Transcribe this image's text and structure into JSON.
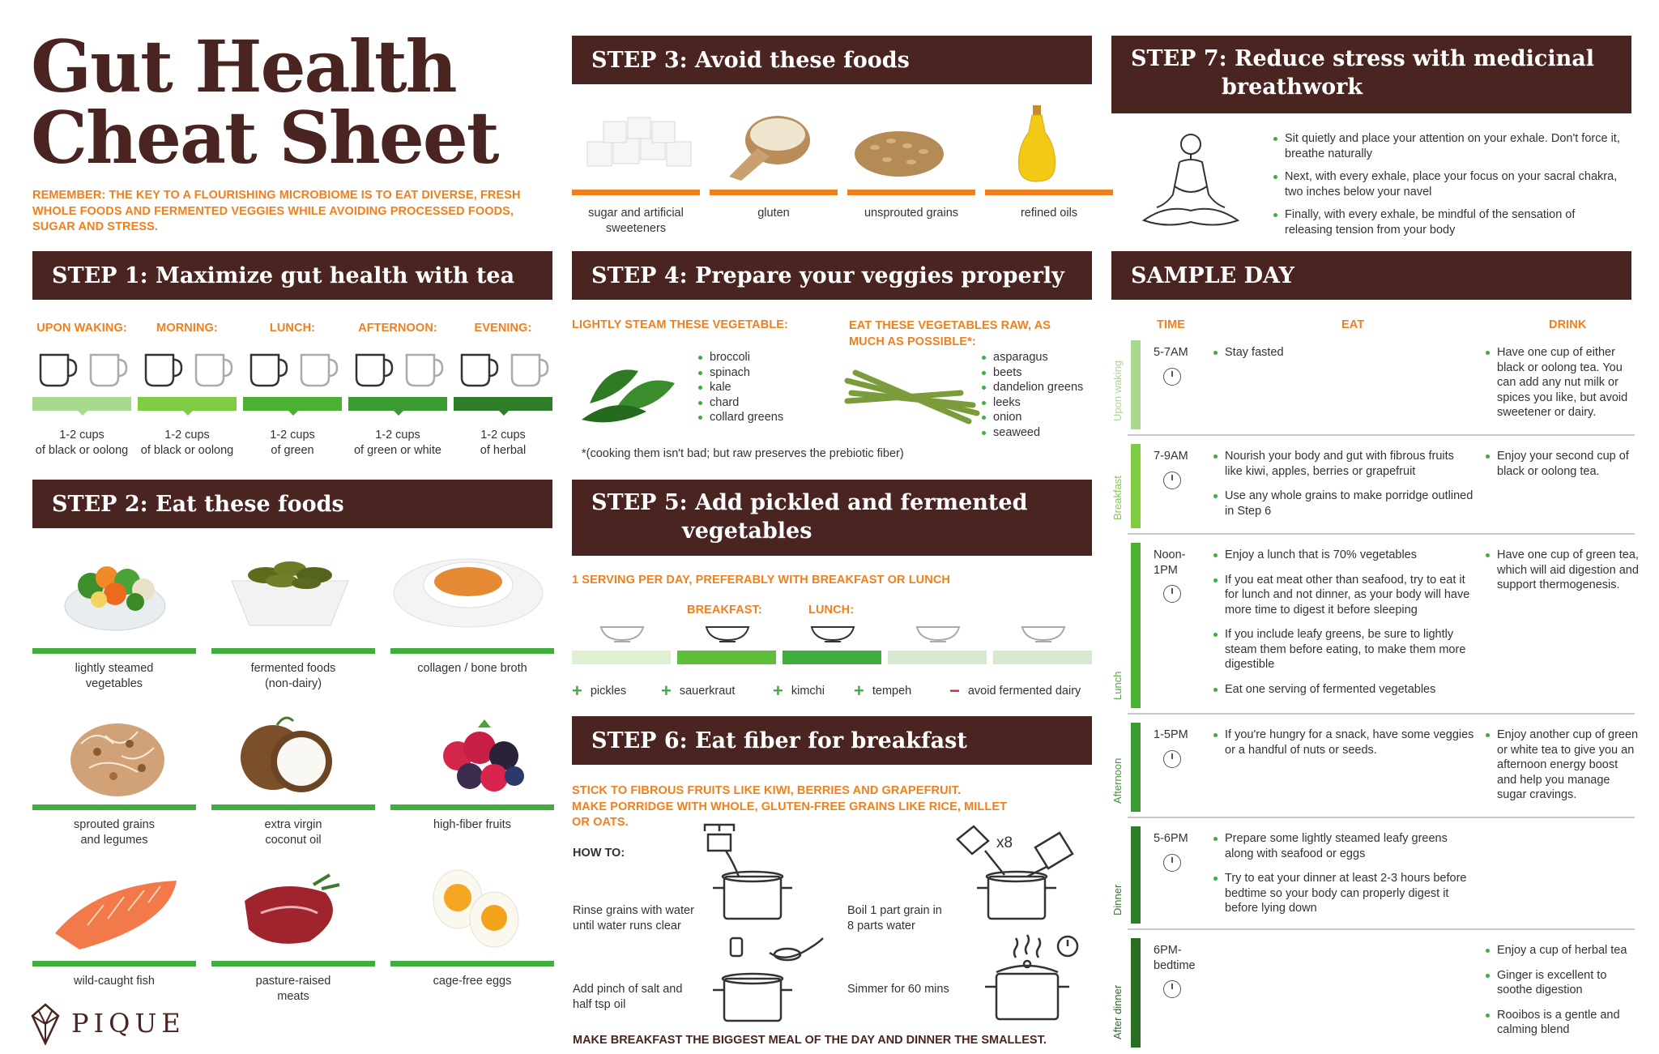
{
  "title": {
    "line1": "Gut Health",
    "line2": "Cheat Sheet"
  },
  "remember": "REMEMBER: THE KEY TO A FLOURISHING MICROBIOME IS TO EAT DIVERSE, FRESH WHOLE FOODS AND FERMENTED VEGGIES WHILE AVOIDING PROCESSED FOODS, SUGAR AND STRESS.",
  "step1": {
    "title": "STEP 1: Maximize gut health with tea",
    "times": [
      {
        "label": "UPON WAKING:",
        "cups": "1-2 cups",
        "tea": "of black or oolong",
        "color": "#a9d88f"
      },
      {
        "label": "MORNING:",
        "cups": "1-2 cups",
        "tea": "of black or oolong",
        "color": "#7fcc45"
      },
      {
        "label": "LUNCH:",
        "cups": "1-2 cups",
        "tea": "of green",
        "color": "#4cb033"
      },
      {
        "label": "AFTERNOON:",
        "cups": "1-2 cups",
        "tea": "of green or white",
        "color": "#3b9a31"
      },
      {
        "label": "EVENING:",
        "cups": "1-2 cups",
        "tea": "of herbal",
        "color": "#2f7e2a"
      }
    ]
  },
  "step2": {
    "title": "STEP 2: Eat these foods",
    "foods": [
      {
        "line1": "lightly steamed",
        "line2": "vegetables"
      },
      {
        "line1": "fermented foods",
        "line2": "(non-dairy)"
      },
      {
        "line1": "collagen / bone broth",
        "line2": ""
      },
      {
        "line1": "sprouted grains",
        "line2": "and legumes"
      },
      {
        "line1": "extra virgin",
        "line2": "coconut oil"
      },
      {
        "line1": "high-fiber fruits",
        "line2": ""
      },
      {
        "line1": "wild-caught fish",
        "line2": ""
      },
      {
        "line1": "pasture-raised",
        "line2": "meats"
      },
      {
        "line1": "cage-free eggs",
        "line2": ""
      }
    ]
  },
  "brand": "PIQUE",
  "step3": {
    "title": "STEP 3: Avoid these foods",
    "items": [
      {
        "line1": "sugar and artificial",
        "line2": "sweeteners"
      },
      {
        "line1": "gluten",
        "line2": ""
      },
      {
        "line1": "unsprouted grains",
        "line2": ""
      },
      {
        "line1": "refined oils",
        "line2": ""
      }
    ]
  },
  "step4": {
    "title": "STEP 4: Prepare your veggies properly",
    "steam_heading": "LIGHTLY STEAM THESE VEGETABLE:",
    "steam_list": [
      "broccoli",
      "spinach",
      "kale",
      "chard",
      "collard greens"
    ],
    "raw_heading_1": "EAT THESE VEGETABLES RAW, AS",
    "raw_heading_2": "MUCH AS POSSIBLE*:",
    "raw_list": [
      "asparagus",
      "beets",
      "dandelion greens",
      "leeks",
      "onion",
      "seaweed"
    ],
    "note": "*(cooking them isn't bad; but raw preserves the prebiotic fiber)"
  },
  "step5": {
    "title_1": "STEP 5: Add pickled and fermented",
    "title_2": "vegetables",
    "subtitle": "1 SERVING PER DAY, PREFERABLY WITH BREAKFAST OR LUNCH",
    "meal_labels": [
      "BREAKFAST:",
      "LUNCH:"
    ],
    "bar_colors": [
      "#dff0d3",
      "#5fbf3c",
      "#3fae3f",
      "#d6e8d0",
      "#d6e8d0"
    ],
    "items": [
      {
        "sign": "+",
        "label": "pickles"
      },
      {
        "sign": "+",
        "label": "sauerkraut"
      },
      {
        "sign": "+",
        "label": "kimchi"
      },
      {
        "sign": "+",
        "label": "tempeh"
      },
      {
        "sign": "−",
        "label": "avoid fermented dairy"
      }
    ]
  },
  "step6": {
    "title": "STEP 6: Eat fiber for breakfast",
    "sub1": "STICK TO FIBROUS FRUITS LIKE KIWI, BERRIES AND GRAPEFRUIT.",
    "sub2": "MAKE PORRIDGE WITH WHOLE, GLUTEN-FREE GRAINS LIKE RICE, MILLET",
    "sub3": "OR OATS.",
    "howto": "HOW TO:",
    "steps": [
      {
        "line1": "Rinse grains with water",
        "line2": "until water runs clear"
      },
      {
        "line1": "Boil 1 part grain in",
        "line2": "8 parts water"
      },
      {
        "line1": "Add pinch of salt and",
        "line2": "half tsp oil"
      },
      {
        "line1": "Simmer for 60 mins",
        "line2": ""
      }
    ],
    "x8": "x8",
    "footer": "MAKE BREAKFAST THE BIGGEST MEAL OF THE DAY AND DINNER THE SMALLEST."
  },
  "step7": {
    "title_1": "STEP 7: Reduce stress with medicinal",
    "title_2": "breathwork",
    "bullets": [
      "Sit quietly and place your attention on your exhale. Don't force it, breathe naturally",
      "Next, with every exhale, place your focus on your sacral chakra, two inches below your navel",
      "Finally, with every exhale, be mindful of the sensation of releasing tension from your body"
    ]
  },
  "sample_day": {
    "title": "SAMPLE DAY",
    "headers": {
      "time": "TIME",
      "eat": "EAT",
      "drink": "DRINK"
    },
    "rows": [
      {
        "phase": "Upon waking",
        "time": "5-7AM",
        "eat": [
          "Stay fasted"
        ],
        "drink": [
          "Have one cup of either black or oolong tea. You can add any nut milk or spices you like, but avoid sweetener or dairy."
        ],
        "color": "#a9d88f"
      },
      {
        "phase": "Breakfast",
        "time": "7-9AM",
        "eat": [
          "Nourish your body and gut with fibrous fruits like kiwi, apples, berries or grapefruit",
          "Use any whole grains to make porridge outlined in Step 6"
        ],
        "drink": [
          "Enjoy your second cup of black or oolong tea."
        ],
        "color": "#7fcc45"
      },
      {
        "phase": "Lunch",
        "time": "Noon-\n1PM",
        "eat": [
          "Enjoy a lunch that is 70% vegetables",
          "If you eat meat other than seafood, try to eat it for lunch and not dinner, as your body will have more time to digest it before sleeping",
          "If you include leafy greens, be sure to lightly steam them before eating, to make them more digestible",
          "Eat one serving of fermented vegetables"
        ],
        "drink": [
          "Have one cup of green tea, which will aid digestion and support thermogenesis."
        ],
        "color": "#4cb033"
      },
      {
        "phase": "Afternoon",
        "time": "1-5PM",
        "eat": [
          "If you're hungry for a snack, have some veggies or a handful of nuts or seeds."
        ],
        "drink": [
          "Enjoy another cup of green or white tea to give you an afternoon energy boost and help you manage sugar cravings."
        ],
        "color": "#3b9a31"
      },
      {
        "phase": "Dinner",
        "time": "5-6PM",
        "eat": [
          "Prepare some lightly steamed leafy greens along with seafood or eggs",
          "Try to eat your dinner at least 2-3 hours before bedtime so your body can properly digest it before lying down"
        ],
        "drink": [],
        "color": "#2f7e2a"
      },
      {
        "phase": "After dinner",
        "time": "6PM-\nbedtime",
        "eat": [],
        "drink": [
          "Enjoy a cup of herbal tea",
          "Ginger is excellent to soothe digestion",
          "Rooibos is a gentle and calming blend"
        ],
        "color": "#2a6e26"
      }
    ]
  }
}
